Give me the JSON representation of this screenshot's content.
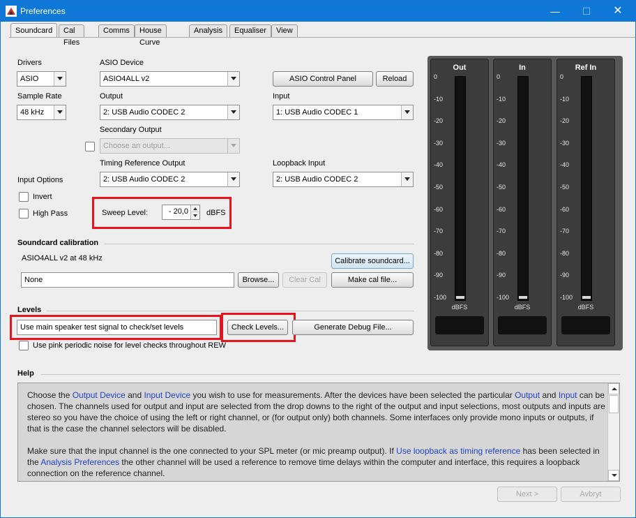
{
  "window": {
    "title": "Preferences",
    "min_glyph": "—",
    "max_glyph": "☐",
    "close_glyph": "✕"
  },
  "tabs": [
    "Soundcard",
    "Cal Files",
    "Comms",
    "House Curve",
    "Analysis",
    "Equaliser",
    "View"
  ],
  "active_tab": "Soundcard",
  "soundcard": {
    "drivers_label": "Drivers",
    "drivers_value": "ASIO",
    "asio_device_label": "ASIO Device",
    "asio_device_value": "ASIO4ALL v2",
    "asio_control_panel": "ASIO Control Panel",
    "reload": "Reload",
    "sample_rate_label": "Sample Rate",
    "sample_rate_value": "48 kHz",
    "output_label": "Output",
    "output_value": "2: USB Audio CODEC  2",
    "input_label": "Input",
    "input_value": "1: USB Audio CODEC  1",
    "secondary_output_label": "Secondary Output",
    "secondary_output_placeholder": "Choose an output...",
    "timing_ref_label": "Timing Reference Output",
    "timing_ref_value": "2: USB Audio CODEC  2",
    "loopback_label": "Loopback Input",
    "loopback_value": "2: USB Audio CODEC  2",
    "input_options_label": "Input Options",
    "invert_label": "Invert",
    "high_pass_label": "High Pass",
    "sweep_level_label": "Sweep Level:",
    "sweep_level_value": "- 20,0",
    "sweep_level_unit": "dBFS"
  },
  "calibration": {
    "section_title": "Soundcard calibration",
    "info": "ASIO4ALL v2 at 48 kHz",
    "calibrate_button": "Calibrate soundcard...",
    "file_value": "None",
    "browse_button": "Browse...",
    "clear_cal_button": "Clear Cal",
    "make_cal_button": "Make cal file..."
  },
  "levels": {
    "section_title": "Levels",
    "mode_value": "Use main speaker test signal to check/set levels",
    "check_levels_button": "Check Levels...",
    "debug_button": "Generate Debug File...",
    "pink_noise_label": "Use pink periodic noise for level checks throughout REW"
  },
  "meters": {
    "ticks": [
      "0",
      "-10",
      "-20",
      "-30",
      "-40",
      "-50",
      "-60",
      "-70",
      "-80",
      "-90",
      "-100"
    ],
    "unit": "dBFS",
    "channels": [
      {
        "title": "Out",
        "level": 0.0
      },
      {
        "title": "In",
        "level": 0.0
      },
      {
        "title": "Ref In",
        "level": 0.0
      }
    ]
  },
  "help": {
    "section_title": "Help",
    "p1": [
      {
        "t": "Choose the "
      },
      {
        "t": "Output Device",
        "link": true
      },
      {
        "t": " and "
      },
      {
        "t": "Input Device",
        "link": true
      },
      {
        "t": " you wish to use for measurements. After the devices have been selected the particular "
      },
      {
        "t": "Output",
        "link": true
      },
      {
        "t": " and "
      },
      {
        "t": "Input",
        "link": true
      },
      {
        "t": " can be chosen. The channels used for output and input are selected from the drop downs to the right of the output and input selections, most outputs and inputs are stereo so you have the choice of using the left or right channel, or (for output only) both channels. Some interfaces only provide mono inputs or outputs, if that is the case the channel selectors will be disabled."
      }
    ],
    "p2": [
      {
        "t": "Make sure that the input channel is the one connected to your SPL meter (or mic preamp output). If "
      },
      {
        "t": "Use loopback as timing reference",
        "link": true
      },
      {
        "t": " has been selected in the "
      },
      {
        "t": "Analysis Preferences",
        "link": true
      },
      {
        "t": " the other channel will be used a reference to remove time delays within the computer and interface, this requires a loopback connection on the reference channel."
      }
    ]
  },
  "footer": {
    "next_button": "Next >",
    "cancel_button": "Avbryt"
  }
}
